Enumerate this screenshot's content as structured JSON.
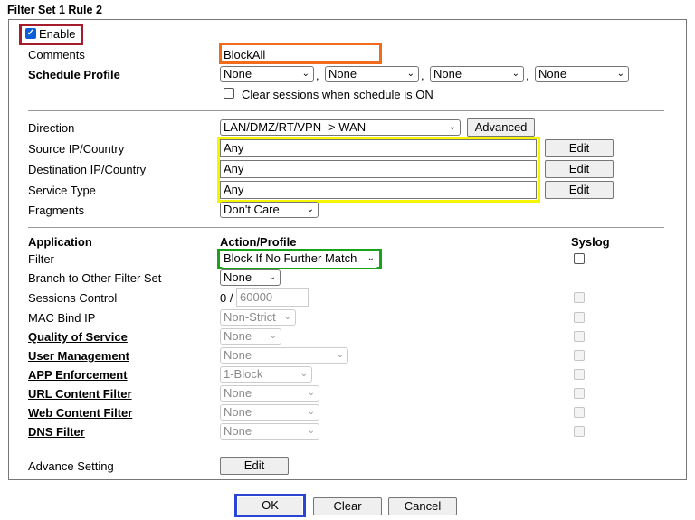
{
  "page_title": "Filter Set 1 Rule 2",
  "enable": {
    "label": "Enable",
    "checked": true
  },
  "comments": {
    "label": "Comments",
    "value": "BlockAll"
  },
  "schedule": {
    "label": "Schedule Profile",
    "profiles": [
      "None",
      "None",
      "None",
      "None"
    ],
    "separator": ",",
    "clear_sessions_label": "Clear sessions when schedule is ON"
  },
  "direction": {
    "label": "Direction",
    "value": "LAN/DMZ/RT/VPN -> WAN",
    "advanced_button": "Advanced"
  },
  "source": {
    "label": "Source IP/Country",
    "value": "Any",
    "edit_button": "Edit"
  },
  "destination": {
    "label": "Destination IP/Country",
    "value": "Any",
    "edit_button": "Edit"
  },
  "service": {
    "label": "Service Type",
    "value": "Any",
    "edit_button": "Edit"
  },
  "fragments": {
    "label": "Fragments",
    "value": "Don't Care"
  },
  "table_headers": {
    "application": "Application",
    "action": "Action/Profile",
    "syslog": "Syslog"
  },
  "filter": {
    "label": "Filter",
    "value": "Block If No Further Match"
  },
  "branch": {
    "label": "Branch to Other Filter Set",
    "value": "None"
  },
  "sessions": {
    "label": "Sessions Control",
    "current": "0 /",
    "max": "60000"
  },
  "mac_bind": {
    "label": "MAC Bind IP",
    "value": "Non-Strict"
  },
  "qos": {
    "label": "Quality of Service",
    "value": "None"
  },
  "user_mgmt": {
    "label": "User Management",
    "value": "None"
  },
  "app_enforcement": {
    "label": "APP Enforcement",
    "value": "1-Block"
  },
  "url_filter": {
    "label": "URL Content Filter",
    "value": "None"
  },
  "web_filter": {
    "label": "Web Content Filter",
    "value": "None"
  },
  "dns_filter": {
    "label": "DNS Filter",
    "value": "None"
  },
  "advance": {
    "label": "Advance Setting",
    "edit_button": "Edit"
  },
  "footer": {
    "ok": "OK",
    "clear": "Clear",
    "cancel": "Cancel"
  },
  "chevron": "⌄",
  "checkmark": "✓",
  "highlight_colors": {
    "red": "#a51d2d",
    "orange": "#f26b1d",
    "yellow": "#f5f500",
    "green": "#1aa31a",
    "blue": "#2a45d6"
  }
}
